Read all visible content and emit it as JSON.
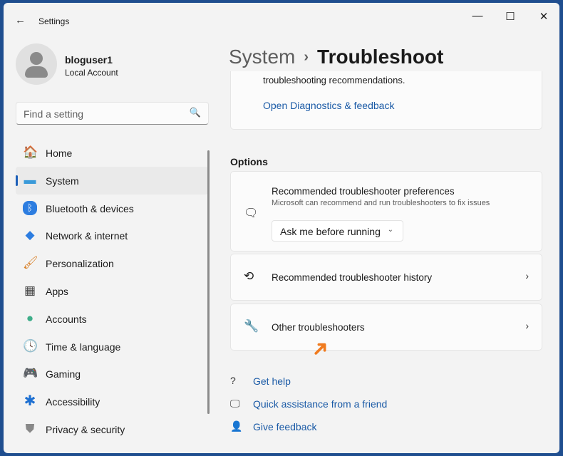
{
  "window": {
    "title": "Settings",
    "minimize": "—",
    "maximize": "☐",
    "close": "✕",
    "back": "←"
  },
  "profile": {
    "name": "bloguser1",
    "type": "Local Account"
  },
  "search": {
    "placeholder": "Find a setting",
    "icon": "🔍"
  },
  "nav": [
    {
      "label": "Home",
      "icon": "🏠"
    },
    {
      "label": "System",
      "icon": "▬",
      "selected": true
    },
    {
      "label": "Bluetooth & devices",
      "icon": "ᛒ"
    },
    {
      "label": "Network & internet",
      "icon": "◆"
    },
    {
      "label": "Personalization",
      "icon": "🖌"
    },
    {
      "label": "Apps",
      "icon": "▦"
    },
    {
      "label": "Accounts",
      "icon": "●"
    },
    {
      "label": "Time & language",
      "icon": "🕓"
    },
    {
      "label": "Gaming",
      "icon": "🎮"
    },
    {
      "label": "Accessibility",
      "icon": "✱"
    },
    {
      "label": "Privacy & security",
      "icon": "⛊"
    }
  ],
  "breadcrumb": {
    "parent": "System",
    "sep": "›",
    "current": "Troubleshoot"
  },
  "top_card": {
    "text": "troubleshooting recommendations.",
    "link": "Open Diagnostics & feedback"
  },
  "options_heading": "Options",
  "prefs": {
    "title": "Recommended troubleshooter preferences",
    "desc": "Microsoft can recommend and run troubleshooters to fix issues",
    "dropdown": "Ask me before running",
    "icon": "🗨"
  },
  "history": {
    "title": "Recommended troubleshooter history",
    "icon": "⟲"
  },
  "other": {
    "title": "Other troubleshooters",
    "icon": "🔧"
  },
  "chevron": "›",
  "links": [
    {
      "label": "Get help",
      "icon": "?"
    },
    {
      "label": "Quick assistance from a friend",
      "icon": "🖵"
    },
    {
      "label": "Give feedback",
      "icon": "👤"
    }
  ]
}
